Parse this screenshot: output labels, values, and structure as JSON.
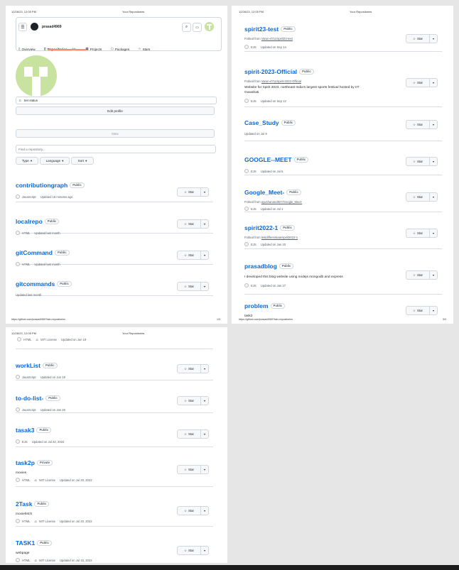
{
  "print": {
    "datetime": "12/26/23, 12:05 PM",
    "page_title": "Your Repositories",
    "url": "https://github.com/prasad4969?tab=repositories",
    "page1_num": "1/3",
    "page2_num": "3/3"
  },
  "header": {
    "username": "prasad4969"
  },
  "tabs": {
    "overview": "Overview",
    "repositories": "Repositories",
    "repo_count": "19",
    "projects": "Projects",
    "packages": "Packages",
    "stars": "Stars"
  },
  "profile": {
    "set_status": "Set status",
    "edit_profile": "Edit profile"
  },
  "toolbar": {
    "new": "New",
    "search_placeholder": "Find a repository...",
    "type": "Type",
    "language": "Language",
    "sort": "Sort"
  },
  "star_label": "Star",
  "page1_repos": [
    {
      "name": "contributiongraph",
      "visibility": "Public",
      "language": "JavaScript",
      "updated": "Updated 16 minutes ago"
    },
    {
      "name": "localrepo",
      "visibility": "Public",
      "language": "HTML",
      "updated": "Updated last month"
    },
    {
      "name": "gitCommand",
      "visibility": "Public",
      "language": "HTML",
      "updated": "Updated last month"
    },
    {
      "name": "gitcommands",
      "visibility": "Public",
      "updated": "Updated last month"
    }
  ],
  "page3_repos": [
    {
      "name": "spirit23-test",
      "visibility": "Public",
      "fork_prefix": "Forked from ",
      "fork_src": "Varun-4711/spirit23-test",
      "language": "EJS",
      "updated": "Updated on Sep 14"
    },
    {
      "name": "spirit-2023-Official",
      "visibility": "Public",
      "fork_prefix": "Forked from ",
      "fork_src": "Varun-4711/spirit-2023-Official",
      "desc": "Website for Spirit 2023, northeast India's largest sports festival hosted by IIT Guwahati.",
      "language": "EJS",
      "updated": "Updated on Sep 12"
    },
    {
      "name": "Case_Study",
      "visibility": "Public",
      "updated": "Updated on Jul 9"
    },
    {
      "name": "GOOGLE--MEET",
      "visibility": "Public",
      "language": "EJS",
      "updated": "Updated on Jul 5"
    },
    {
      "name": "Google_Meet-",
      "visibility": "Public",
      "fork_prefix": "Forked from ",
      "fork_src": "ayushanand827/Google_Meet-",
      "language": "EJS",
      "updated": "Updated on Jul 1"
    },
    {
      "name": "spirit2022-1",
      "visibility": "Public",
      "fork_prefix": "Forked from ",
      "fork_src": "letsdifferentiate/spirit2022-1",
      "language": "EJS",
      "updated": "Updated on Jan 20"
    },
    {
      "name": "prasadblog",
      "visibility": "Public",
      "desc": "I developed this blog website using nodejs mongodb and express",
      "language": "EJS",
      "updated": "Updated on Jan 27"
    },
    {
      "name": "problem",
      "visibility": "Public",
      "desc": "task2"
    }
  ],
  "page2_top": {
    "language": "HTML",
    "license": "MIT License",
    "updated": "Updated on Jun 19"
  },
  "page2_repos": [
    {
      "name": "workList",
      "visibility": "Public",
      "language": "JavaScript",
      "updated": "Updated on Jun 19"
    },
    {
      "name": "to-do-list-",
      "visibility": "Public",
      "language": "JavaScript",
      "updated": "Updated on Jan 26"
    },
    {
      "name": "tasak3",
      "visibility": "Public",
      "language": "EJS",
      "updated": "Updated on Jul 22, 2022"
    },
    {
      "name": "task2p",
      "visibility": "Private",
      "desc": "movies",
      "language": "HTML",
      "license": "MIT License",
      "updated": "Updated on Jul 20, 2022"
    },
    {
      "name": "2Task",
      "visibility": "Public",
      "desc": "moviefetch",
      "language": "HTML",
      "license": "MIT License",
      "updated": "Updated on Jul 20, 2022"
    },
    {
      "name": "TASK1",
      "visibility": "Public",
      "desc": "webpage",
      "language": "HTML",
      "license": "MIT License",
      "updated": "Updated on Jul 15, 2022"
    }
  ]
}
